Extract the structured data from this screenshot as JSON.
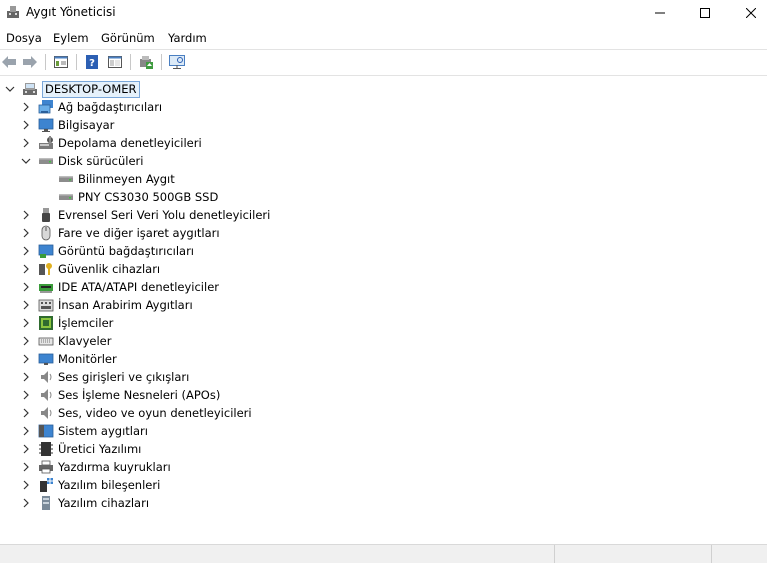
{
  "window": {
    "title": "Aygıt Yöneticisi",
    "minimize_glyph": "—",
    "maximize_glyph": "☐",
    "close_glyph": "✕"
  },
  "menu": [
    "Dosya",
    "Eylem",
    "Görünüm",
    "Yardım"
  ],
  "toolbar": {
    "buttons": [
      "back-icon",
      "forward-icon",
      "properties-icon",
      "help-icon",
      "view-icon",
      "update-driver-icon",
      "scan-hardware-icon"
    ]
  },
  "tree": {
    "root": {
      "label": "DESKTOP-OMER",
      "icon": "computer-icon",
      "expanded": true
    },
    "items": [
      {
        "label": "Ağ bağdaştırıcıları",
        "icon": "network-adapter-icon",
        "expanded": false
      },
      {
        "label": "Bilgisayar",
        "icon": "computer-monitor-icon",
        "expanded": false
      },
      {
        "label": "Depolama denetleyicileri",
        "icon": "storage-controller-icon",
        "expanded": false
      },
      {
        "label": "Disk sürücüleri",
        "icon": "disk-drive-icon",
        "expanded": true,
        "children": [
          {
            "label": "Bilinmeyen Aygıt",
            "icon": "disk-drive-icon"
          },
          {
            "label": "PNY CS3030 500GB SSD",
            "icon": "disk-drive-icon"
          }
        ]
      },
      {
        "label": "Evrensel Seri Veri Yolu denetleyicileri",
        "icon": "usb-icon",
        "expanded": false
      },
      {
        "label": "Fare ve diğer işaret aygıtları",
        "icon": "mouse-icon",
        "expanded": false
      },
      {
        "label": "Görüntü bağdaştırıcıları",
        "icon": "display-adapter-icon",
        "expanded": false
      },
      {
        "label": "Güvenlik cihazları",
        "icon": "security-key-icon",
        "expanded": false
      },
      {
        "label": "IDE ATA/ATAPI denetleyiciler",
        "icon": "ide-controller-icon",
        "expanded": false
      },
      {
        "label": "İnsan Arabirim Aygıtları",
        "icon": "hid-icon",
        "expanded": false
      },
      {
        "label": "İşlemciler",
        "icon": "processor-icon",
        "expanded": false
      },
      {
        "label": "Klavyeler",
        "icon": "keyboard-icon",
        "expanded": false
      },
      {
        "label": "Monitörler",
        "icon": "monitor-icon",
        "expanded": false
      },
      {
        "label": "Ses girişleri ve çıkışları",
        "icon": "speaker-icon",
        "expanded": false
      },
      {
        "label": "Ses İşleme Nesneleri (APOs)",
        "icon": "speaker-icon",
        "expanded": false
      },
      {
        "label": "Ses, video ve oyun denetleyicileri",
        "icon": "speaker-icon",
        "expanded": false
      },
      {
        "label": "Sistem aygıtları",
        "icon": "system-devices-icon",
        "expanded": false
      },
      {
        "label": "Üretici Yazılımı",
        "icon": "firmware-icon",
        "expanded": false
      },
      {
        "label": "Yazdırma kuyrukları",
        "icon": "printer-icon",
        "expanded": false
      },
      {
        "label": "Yazılım bileşenleri",
        "icon": "software-component-icon",
        "expanded": false
      },
      {
        "label": "Yazılım cihazları",
        "icon": "software-device-icon",
        "expanded": false
      }
    ]
  },
  "colors": {
    "selection": "#e5f1fb",
    "selection_border": "#7aa7d9",
    "statusbar": "#f0f0f0"
  }
}
